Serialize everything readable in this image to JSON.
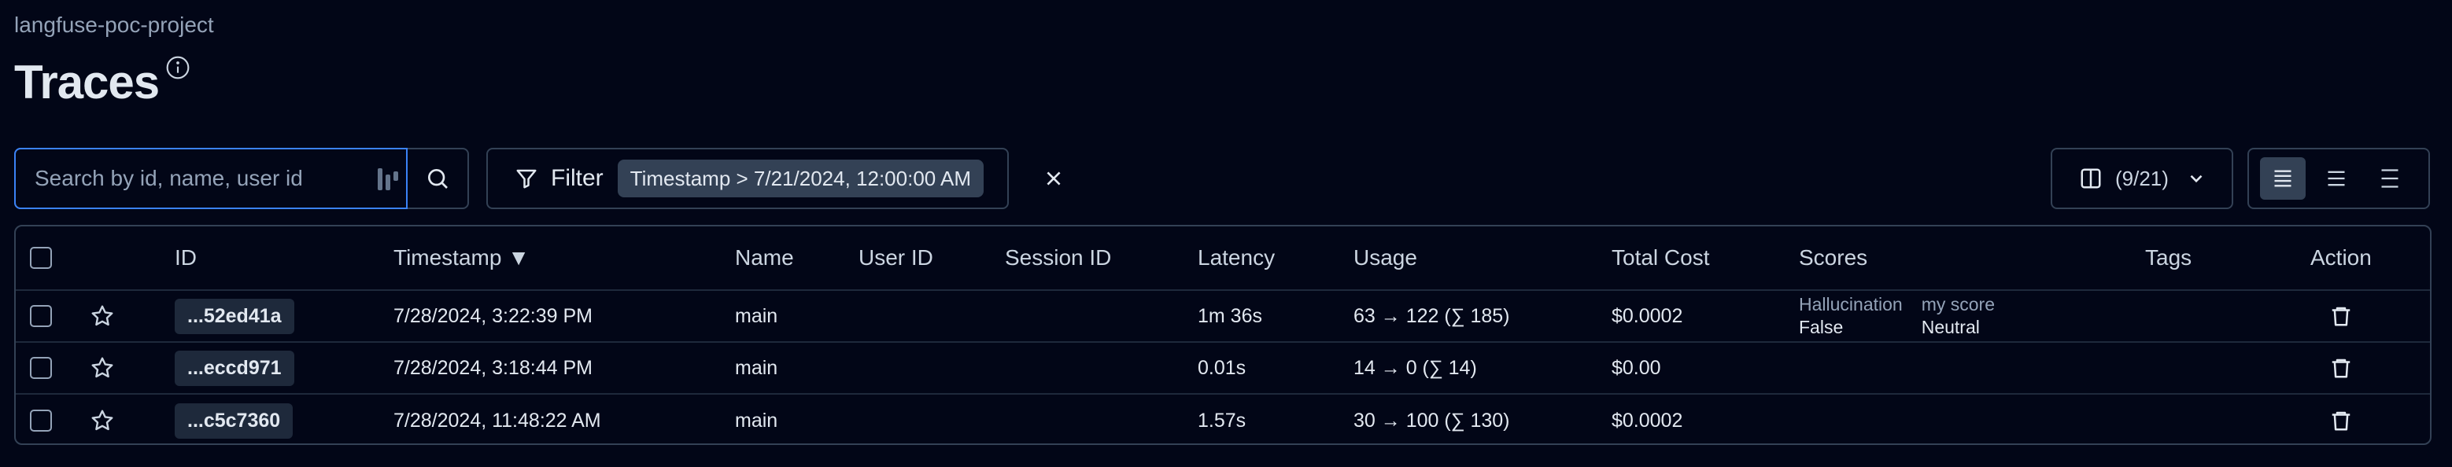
{
  "project": "langfuse-poc-project",
  "page_title": "Traces",
  "icons": {
    "info": "info-circle-icon",
    "password_manager": "password-manager-icon",
    "search": "search-icon",
    "filter": "filter-icon",
    "clear": "close-icon",
    "columns": "columns-icon",
    "chevron": "chevron-down-icon",
    "density_compact": "density-compact-icon",
    "density_standard": "density-standard-icon",
    "density_comfortable": "density-comfortable-icon",
    "star": "star-icon",
    "trash": "trash-icon"
  },
  "search": {
    "placeholder": "Search by id, name, user id",
    "value": ""
  },
  "filter": {
    "label": "Filter",
    "active_filter": "Timestamp > 7/21/2024, 12:00:00 AM"
  },
  "columns": {
    "count": "(9/21)"
  },
  "table": {
    "headers": {
      "id": "ID",
      "timestamp": "Timestamp ▼",
      "name": "Name",
      "user_id": "User ID",
      "session_id": "Session ID",
      "latency": "Latency",
      "usage": "Usage",
      "total_cost": "Total Cost",
      "scores": "Scores",
      "tags": "Tags",
      "action": "Action"
    },
    "rows": [
      {
        "id": "...52ed41a",
        "timestamp": "7/28/2024, 3:22:39 PM",
        "name": "main",
        "latency": "1m 36s",
        "usage": "63 → 122 (∑ 185)",
        "total_cost": "$0.0002",
        "scores": [
          {
            "name": "Hallucination",
            "value": "False"
          },
          {
            "name": "my score",
            "value": "Neutral"
          }
        ]
      },
      {
        "id": "...eccd971",
        "timestamp": "7/28/2024, 3:18:44 PM",
        "name": "main",
        "latency": "0.01s",
        "usage": "14 → 0 (∑ 14)",
        "total_cost": "$0.00",
        "scores": []
      },
      {
        "id": "...c5c7360",
        "timestamp": "7/28/2024, 11:48:22 AM",
        "name": "main",
        "latency": "1.57s",
        "usage": "30 → 100 (∑ 130)",
        "total_cost": "$0.0002",
        "scores": []
      }
    ]
  }
}
